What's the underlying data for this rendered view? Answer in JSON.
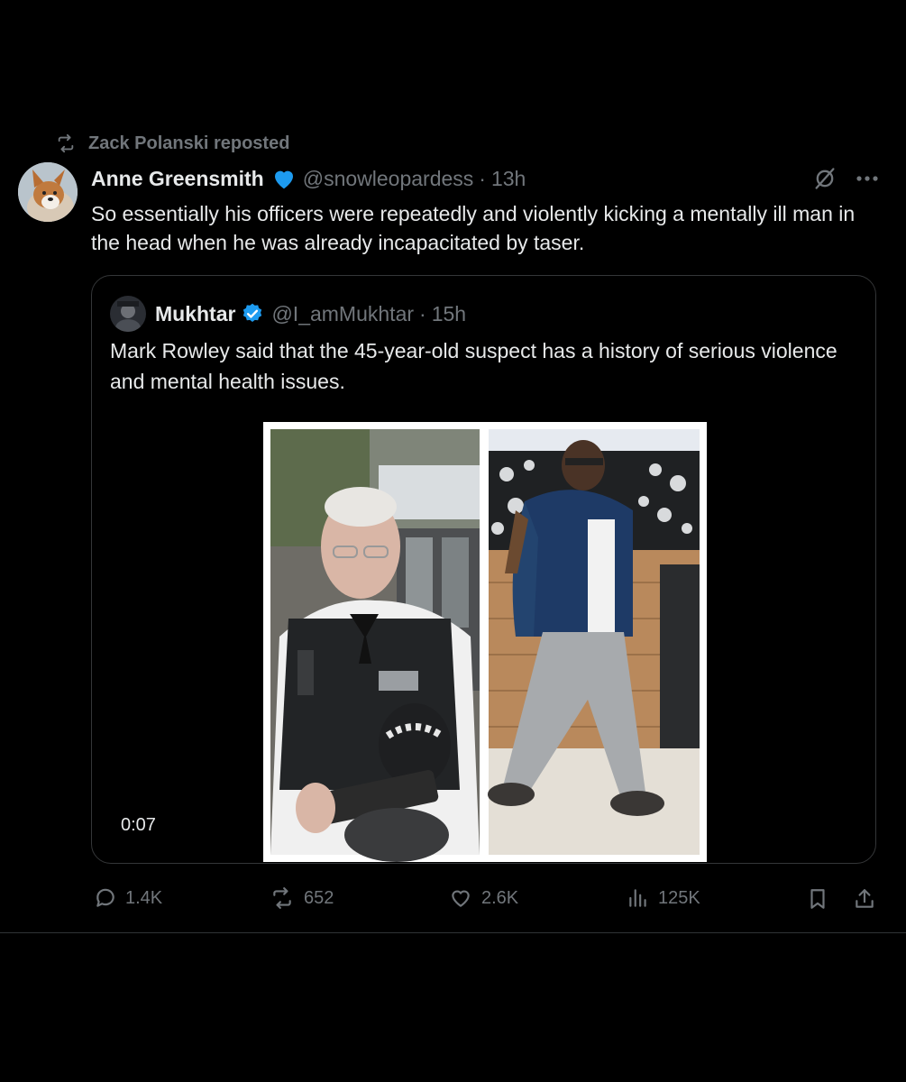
{
  "repost": {
    "label": "Zack Polanski reposted"
  },
  "tweet": {
    "name": "Anne Greensmith",
    "handle": "@snowleopardess",
    "separator": "·",
    "time": "13h",
    "text": "So essentially his officers were repeatedly and violently kicking a mentally ill man in the head when he was already incapacitated by taser."
  },
  "quote": {
    "name": "Mukhtar",
    "handle": "@I_amMukhtar",
    "separator": "·",
    "time": "15h",
    "text": "Mark Rowley said that the 45-year-old suspect has a history of serious violence and mental health issues.",
    "video_time": "0:07"
  },
  "actions": {
    "replies": "1.4K",
    "reposts": "652",
    "likes": "2.6K",
    "views": "125K"
  },
  "colors": {
    "background": "#000000",
    "text": "#e7e9ea",
    "muted": "#71767b",
    "verified_blue": "#1d9bf0",
    "border": "#343638"
  }
}
